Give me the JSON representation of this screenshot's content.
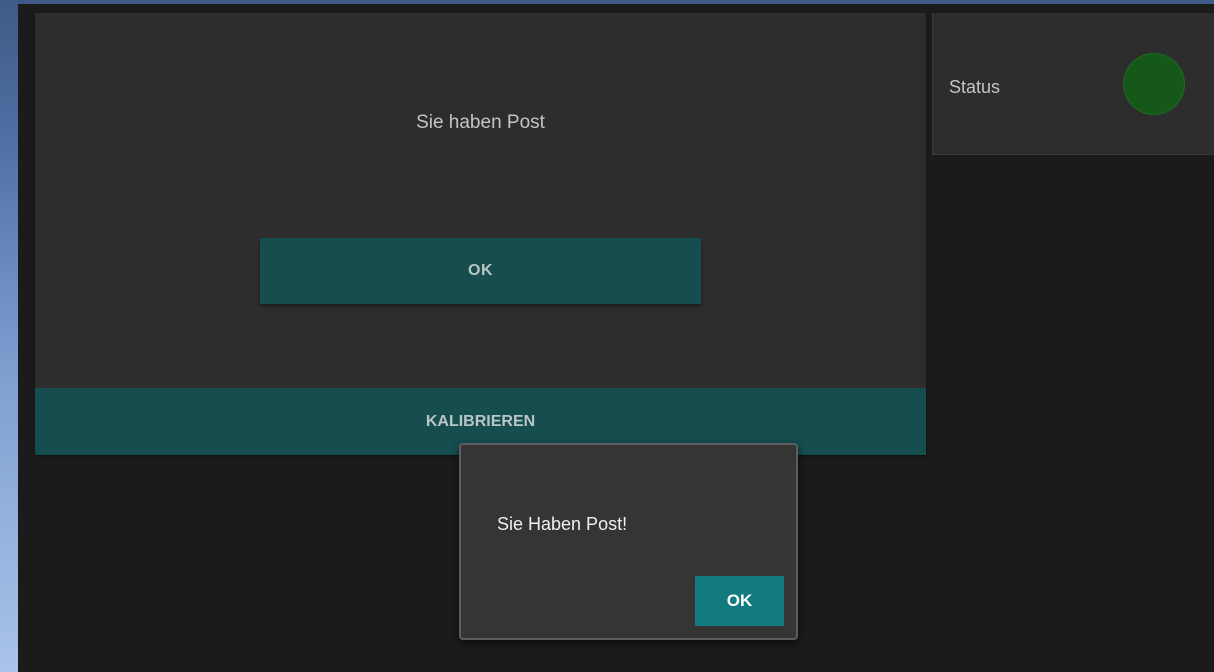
{
  "mail_panel": {
    "message": "Sie haben Post",
    "ok_label": "OK",
    "calibrate_label": "KALIBRIEREN"
  },
  "status_panel": {
    "label": "Status",
    "indicator_color": "#15581a",
    "indicator_icon": "status-indicator-icon"
  },
  "dialog": {
    "message": "Sie Haben Post!",
    "ok_label": "OK"
  },
  "colors": {
    "accent_dark": "#164d4f",
    "accent_dialog": "#137b80",
    "panel_bg": "#2d2d2d",
    "app_bg": "#1b1b1b"
  }
}
